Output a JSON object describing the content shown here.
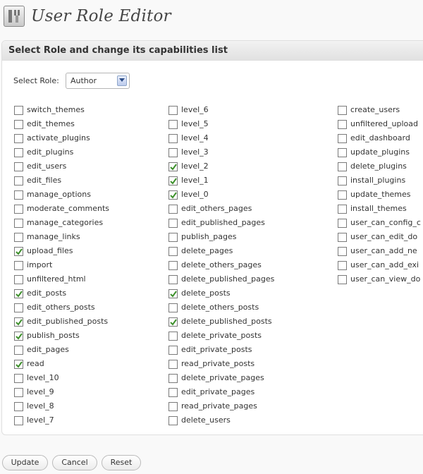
{
  "header": {
    "title": "User Role Editor",
    "logo_icon": "toolbox-icon"
  },
  "panel": {
    "title": "Select Role and change its capabilities list"
  },
  "role_select": {
    "label": "Select Role:",
    "value": "Author"
  },
  "columns": [
    [
      {
        "name": "switch_themes",
        "checked": false
      },
      {
        "name": "edit_themes",
        "checked": false
      },
      {
        "name": "activate_plugins",
        "checked": false
      },
      {
        "name": "edit_plugins",
        "checked": false
      },
      {
        "name": "edit_users",
        "checked": false
      },
      {
        "name": "edit_files",
        "checked": false
      },
      {
        "name": "manage_options",
        "checked": false
      },
      {
        "name": "moderate_comments",
        "checked": false
      },
      {
        "name": "manage_categories",
        "checked": false
      },
      {
        "name": "manage_links",
        "checked": false
      },
      {
        "name": "upload_files",
        "checked": true
      },
      {
        "name": "import",
        "checked": false
      },
      {
        "name": "unfiltered_html",
        "checked": false
      },
      {
        "name": "edit_posts",
        "checked": true
      },
      {
        "name": "edit_others_posts",
        "checked": false
      },
      {
        "name": "edit_published_posts",
        "checked": true
      },
      {
        "name": "publish_posts",
        "checked": true
      },
      {
        "name": "edit_pages",
        "checked": false
      },
      {
        "name": "read",
        "checked": true
      },
      {
        "name": "level_10",
        "checked": false
      },
      {
        "name": "level_9",
        "checked": false
      },
      {
        "name": "level_8",
        "checked": false
      },
      {
        "name": "level_7",
        "checked": false
      }
    ],
    [
      {
        "name": "level_6",
        "checked": false
      },
      {
        "name": "level_5",
        "checked": false
      },
      {
        "name": "level_4",
        "checked": false
      },
      {
        "name": "level_3",
        "checked": false
      },
      {
        "name": "level_2",
        "checked": true
      },
      {
        "name": "level_1",
        "checked": true
      },
      {
        "name": "level_0",
        "checked": true
      },
      {
        "name": "edit_others_pages",
        "checked": false
      },
      {
        "name": "edit_published_pages",
        "checked": false
      },
      {
        "name": "publish_pages",
        "checked": false
      },
      {
        "name": "delete_pages",
        "checked": false
      },
      {
        "name": "delete_others_pages",
        "checked": false
      },
      {
        "name": "delete_published_pages",
        "checked": false
      },
      {
        "name": "delete_posts",
        "checked": true
      },
      {
        "name": "delete_others_posts",
        "checked": false
      },
      {
        "name": "delete_published_posts",
        "checked": true
      },
      {
        "name": "delete_private_posts",
        "checked": false
      },
      {
        "name": "edit_private_posts",
        "checked": false
      },
      {
        "name": "read_private_posts",
        "checked": false
      },
      {
        "name": "delete_private_pages",
        "checked": false
      },
      {
        "name": "edit_private_pages",
        "checked": false
      },
      {
        "name": "read_private_pages",
        "checked": false
      },
      {
        "name": "delete_users",
        "checked": false
      }
    ],
    [
      {
        "name": "create_users",
        "checked": false
      },
      {
        "name": "unfiltered_upload",
        "checked": false
      },
      {
        "name": "edit_dashboard",
        "checked": false
      },
      {
        "name": "update_plugins",
        "checked": false
      },
      {
        "name": "delete_plugins",
        "checked": false
      },
      {
        "name": "install_plugins",
        "checked": false
      },
      {
        "name": "update_themes",
        "checked": false
      },
      {
        "name": "install_themes",
        "checked": false
      },
      {
        "name": "user_can_config_c",
        "checked": false
      },
      {
        "name": "user_can_edit_do",
        "checked": false
      },
      {
        "name": "user_can_add_ne",
        "checked": false
      },
      {
        "name": "user_can_add_exi",
        "checked": false
      },
      {
        "name": "user_can_view_do",
        "checked": false
      }
    ]
  ],
  "actions": {
    "update_label": "Update",
    "cancel_label": "Cancel",
    "reset_label": "Reset"
  },
  "colors": {
    "checkmark": "#3c8f2a",
    "panel_header": "#e8e8e8"
  }
}
